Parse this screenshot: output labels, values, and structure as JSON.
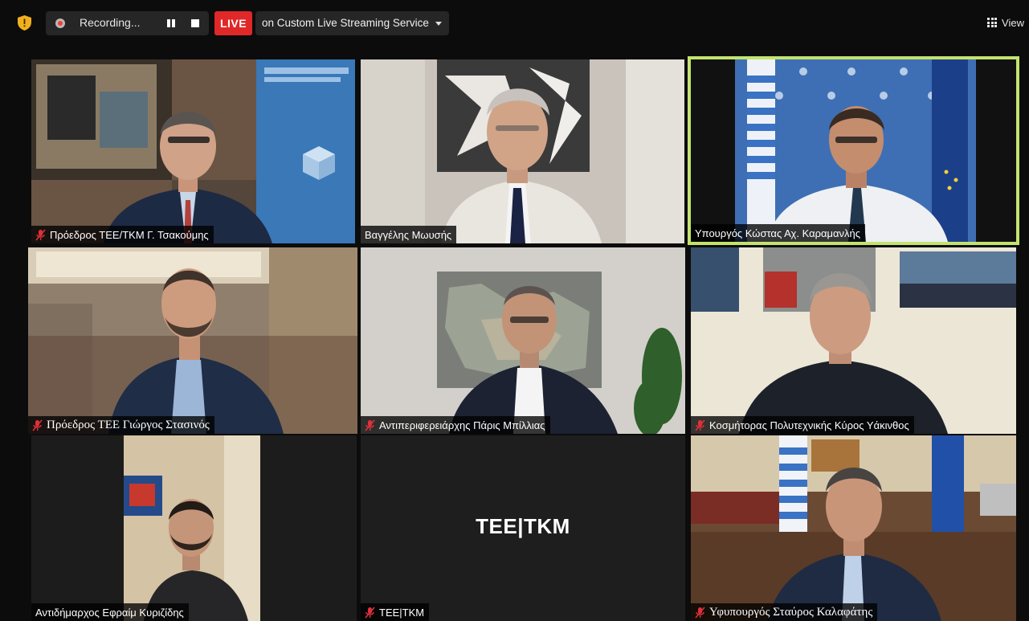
{
  "toolbar": {
    "recording_label": "Recording...",
    "live_label": "LIVE",
    "stream_label": "on Custom Live Streaming Service",
    "view_label": "View",
    "icons": [
      "shield-icon",
      "record-icon",
      "pause-icon",
      "stop-icon",
      "caret-down-icon",
      "grid-view-icon"
    ]
  },
  "colors": {
    "background": "#0c0c0c",
    "live_red": "#e02828",
    "active_speaker_border": "#c4e36d",
    "mic_muted": "#e0303a"
  },
  "participants": [
    {
      "name": "Πρόεδρος ΤΕΕ/ΤΚΜ Γ. Τσακούμης",
      "muted": true,
      "active_speaker": false
    },
    {
      "name": "Βαγγέλης Μωυσής",
      "muted": false,
      "active_speaker": false
    },
    {
      "name": "Υπουργός Κώστας Αχ. Καραμανλής",
      "muted": false,
      "active_speaker": true
    },
    {
      "name": "Πρόεδρος ΤΕΕ Γιώργος Στασινός",
      "muted": true,
      "active_speaker": false
    },
    {
      "name": "Αντιπεριφερειάρχης Πάρις Μπίλλιας",
      "muted": true,
      "active_speaker": false
    },
    {
      "name": "Κοσμήτορας Πολυτεχνικής Κύρος Υάκινθος",
      "muted": true,
      "active_speaker": false
    },
    {
      "name": "Αντιδήμαρχος Εφραίμ Κυριζίδης",
      "muted": false,
      "active_speaker": false
    },
    {
      "name": "ΤΕΕ|ΤΚΜ",
      "muted": true,
      "active_speaker": false,
      "video_off_label": "ΤΕΕ|ΤΚΜ"
    },
    {
      "name": "Υφυπουργός Σταύρος Καλαφάτης",
      "muted": true,
      "active_speaker": false
    }
  ],
  "backgrounds": {
    "banner_text": "TEE TKM"
  }
}
